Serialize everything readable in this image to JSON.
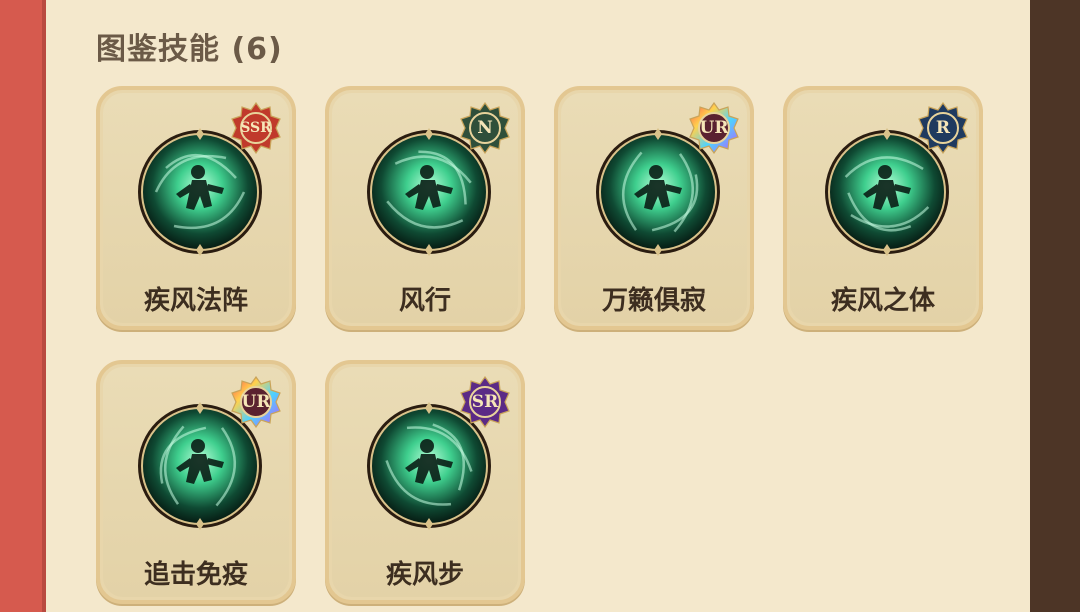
{
  "title": "图鉴技能 (6)",
  "skills": [
    {
      "name": "疾风法阵",
      "rarity": "SSR",
      "icon": "whirlwind-circle-icon"
    },
    {
      "name": "风行",
      "rarity": "N",
      "icon": "dashing-figure-icon"
    },
    {
      "name": "万籁俱寂",
      "rarity": "UR",
      "icon": "leaping-warrior-icon"
    },
    {
      "name": "疾风之体",
      "rarity": "R",
      "icon": "wind-body-figure-icon"
    },
    {
      "name": "追击免疫",
      "rarity": "UR",
      "icon": "running-figure-icon"
    },
    {
      "name": "疾风步",
      "rarity": "SR",
      "icon": "sprinting-figure-icon"
    }
  ],
  "colors": {
    "background": "#f4e8cc",
    "card_border": "#e3c791",
    "SSR": "#c0392b",
    "N": "#2f4f3a",
    "UR": "#8e44ad",
    "R": "#1f3a5f",
    "SR": "#5b2a86",
    "orb_glow": "#3fcf8e"
  }
}
